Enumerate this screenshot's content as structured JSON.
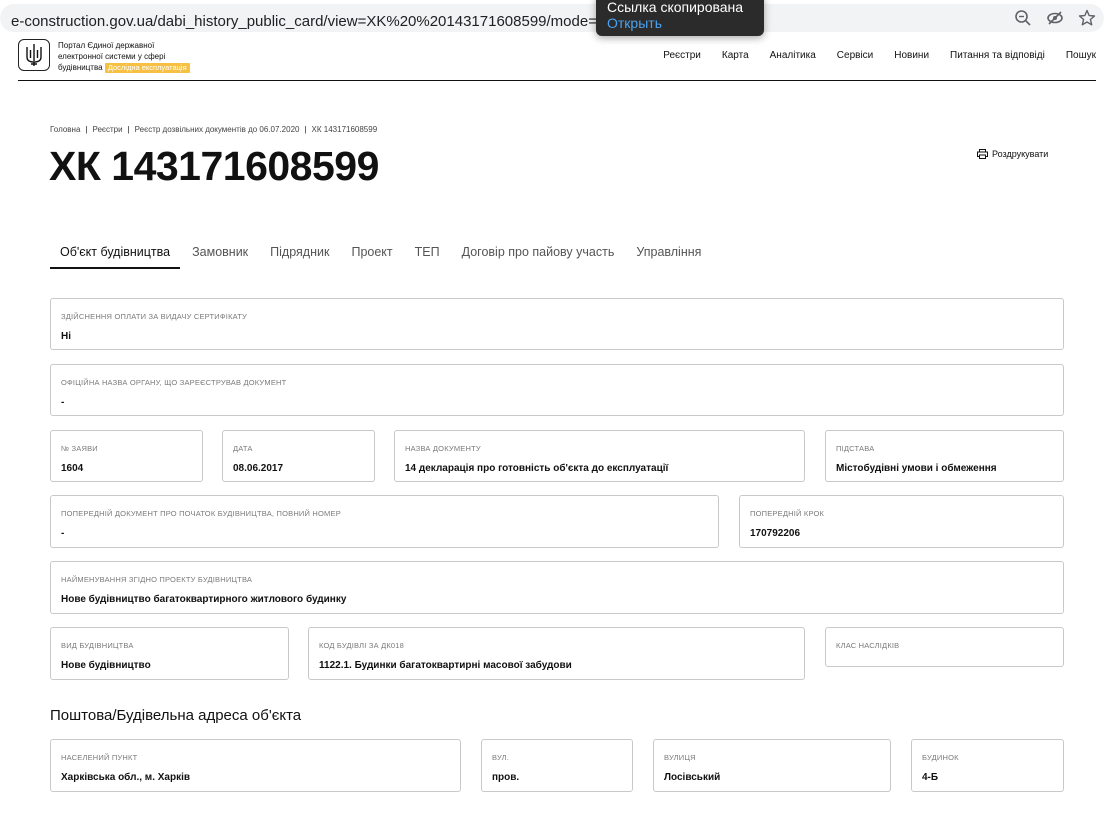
{
  "browser": {
    "url": "e-construction.gov.ua/dabi_history_public_card/view=XK%20%20143171608599/mode=c",
    "toast_title": "Ссылка скопирована",
    "toast_action": "Открыть"
  },
  "header": {
    "brand_line1": "Портал Єдиної державної",
    "brand_line2": "електронної системи у сфері",
    "brand_line3": "будівництва",
    "badge": "Дослідна експлуатація",
    "nav": [
      "Реєстри",
      "Карта",
      "Аналітика",
      "Сервіси",
      "Новини",
      "Питання та відповіді",
      "Пошук"
    ]
  },
  "breadcrumb": [
    "Головна",
    "Реєстри",
    "Реєстр дозвільних документів до 06.07.2020",
    "ХК 143171608599"
  ],
  "page": {
    "title": "ХК 143171608599",
    "print_label": "Роздрукувати"
  },
  "tabs": [
    "Об'єкт будівництва",
    "Замовник",
    "Підрядник",
    "Проект",
    "ТЕП",
    "Договір про пайову участь",
    "Управління"
  ],
  "fields": {
    "payment": {
      "label": "Здійснення оплати за видачу сертифікату",
      "value": "Ні"
    },
    "authority": {
      "label": "Офіційна назва органу, що зареєстрував документ",
      "value": "-"
    },
    "app_no": {
      "label": "№ заяви",
      "value": "1604"
    },
    "date": {
      "label": "Дата",
      "value": "08.06.2017"
    },
    "doc_name": {
      "label": "Назва документу",
      "value": "14 декларація про готовність об'єкта до експлуатації"
    },
    "basis": {
      "label": "Підстава",
      "value": "Містобудівні умови і обмеження"
    },
    "prev_doc": {
      "label": "Попередній документ про початок будівництва, повний номер",
      "value": "-"
    },
    "prev_step": {
      "label": "Попередній крок",
      "value": "170792206"
    },
    "project_name": {
      "label": "Найменування згідно проекту будівництва",
      "value": "Нове будівництво багатоквартирного житлового будинку"
    },
    "build_type": {
      "label": "Вид будівництва",
      "value": "Нове будівництво"
    },
    "building_code": {
      "label": "Код будівлі за ДК018",
      "value": "1122.1. Будинки багатоквартирні масової забудови"
    },
    "consequence_class": {
      "label": "Клас наслідків",
      "value": ""
    }
  },
  "address": {
    "title": "Поштова/Будівельна адреса об'єкта",
    "settlement": {
      "label": "Населений пункт",
      "value": "Харківська обл., м. Харків"
    },
    "street_type": {
      "label": "Вул.",
      "value": "пров."
    },
    "street": {
      "label": "Вулиця",
      "value": "Лосівський"
    },
    "house": {
      "label": "Будинок",
      "value": "4-Б"
    }
  }
}
